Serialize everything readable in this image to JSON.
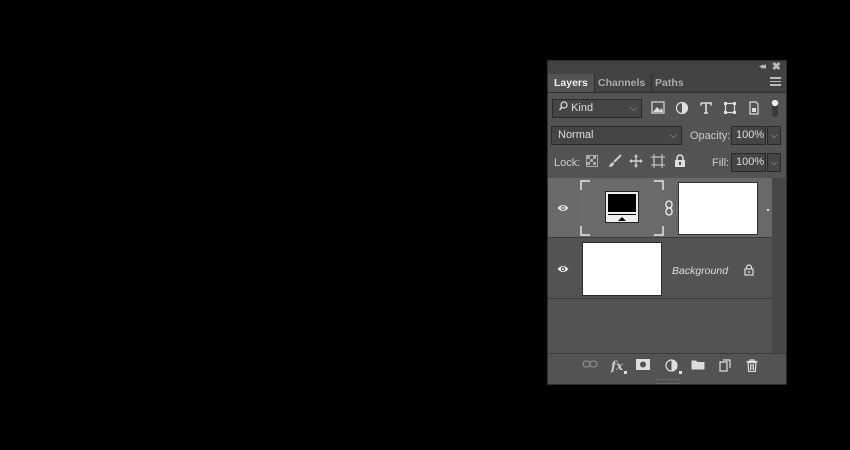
{
  "panel": {
    "tabs": [
      {
        "label": "Layers",
        "active": true
      },
      {
        "label": "Channels",
        "active": false
      },
      {
        "label": "Paths",
        "active": false
      }
    ],
    "collapse_glyph": "◂◂",
    "close_glyph": "✖"
  },
  "filter": {
    "kind_label": "Kind",
    "icons": [
      "image-filter-icon",
      "adjustment-filter-icon",
      "type-filter-icon",
      "shape-filter-icon",
      "smart-object-filter-icon",
      "filter-toggle-icon"
    ]
  },
  "blend": {
    "mode": "Normal",
    "opacity_label": "Opacity:",
    "opacity_value": "100%"
  },
  "lock": {
    "label": "Lock:",
    "fill_label": "Fill:",
    "fill_value": "100%"
  },
  "layers": [
    {
      "name": "",
      "visible": true,
      "selected": true,
      "has_mask": true
    },
    {
      "name": "Background",
      "visible": true,
      "selected": false,
      "locked": true
    }
  ],
  "bottom_icons": [
    "link-layers-icon",
    "fx-icon",
    "add-mask-icon",
    "adjustment-layer-icon",
    "new-group-icon",
    "new-layer-icon",
    "delete-icon"
  ],
  "fx_label": "fx",
  "colors": {
    "panel": "#535353",
    "selected_row": "#696969",
    "background": "#000000"
  }
}
